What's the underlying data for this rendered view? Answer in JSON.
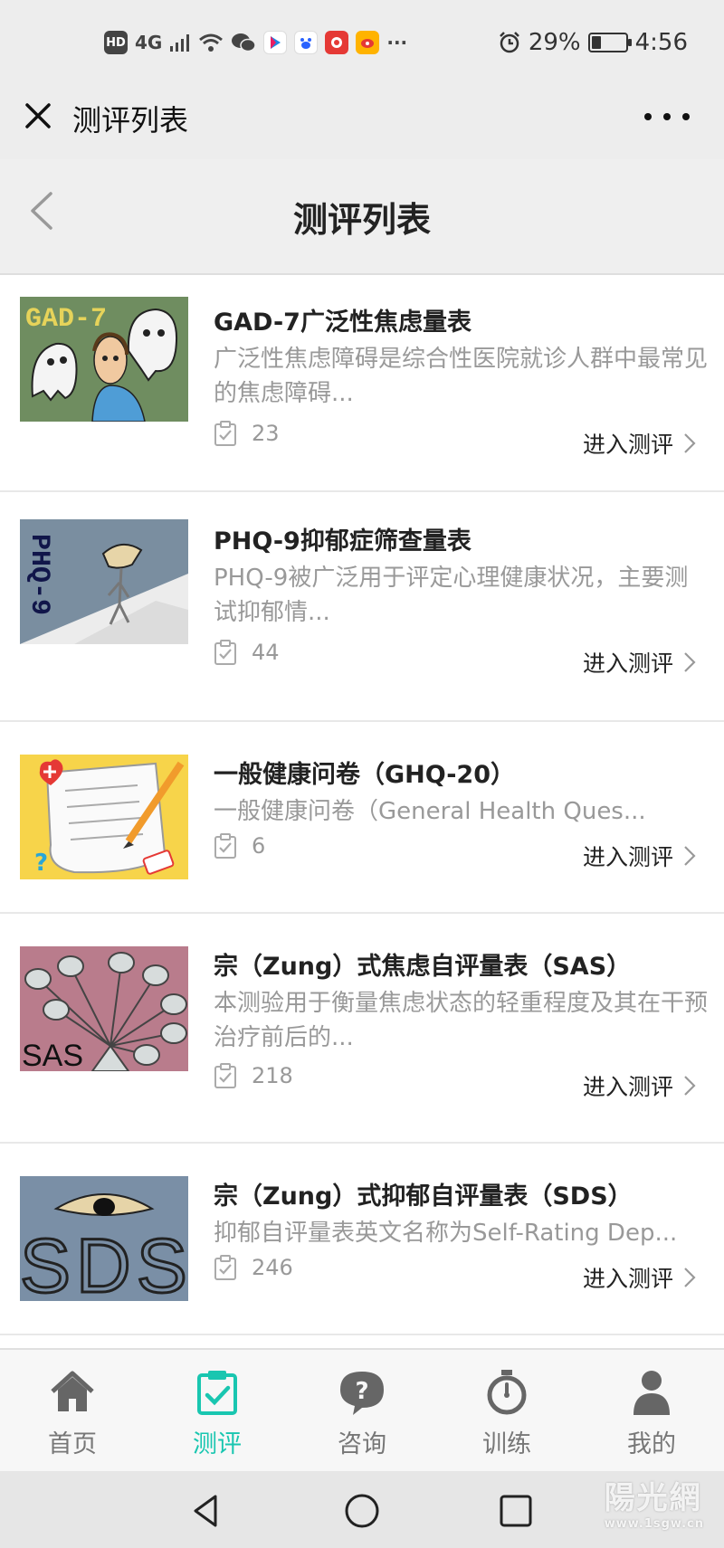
{
  "status_bar": {
    "left_indicators": [
      "HD",
      "4G"
    ],
    "icons": [
      "wifi-icon",
      "wechat-icon",
      "youku-icon",
      "baidu-icon",
      "app-icon",
      "weibo-icon"
    ],
    "overflow": "···",
    "battery": "29%",
    "battery_level": 0.29,
    "time": "4:56"
  },
  "navbar": {
    "title": "测评列表"
  },
  "header": {
    "title": "测评列表"
  },
  "items": [
    {
      "title": "GAD-7广泛性焦虑量表",
      "desc": "广泛性焦虑障碍是综合性医院就诊人群中最常见的焦虑障碍...",
      "count": "23",
      "action": "进入测评",
      "thumb_text": "GAD-7"
    },
    {
      "title": "PHQ-9抑郁症筛查量表",
      "desc": "PHQ-9被广泛用于评定心理健康状况，主要测试抑郁情...",
      "count": "44",
      "action": "进入测评",
      "thumb_text": "PHQ-9"
    },
    {
      "title": "一般健康问卷（GHQ-20）",
      "desc": "一般健康问卷（General Health Ques...",
      "count": "6",
      "action": "进入测评"
    },
    {
      "title": "宗（Zung）式焦虑自评量表（SAS）",
      "desc": "本测验用于衡量焦虑状态的轻重程度及其在干预治疗前后的...",
      "count": "218",
      "action": "进入测评",
      "thumb_text": "SAS"
    },
    {
      "title": "宗（Zung）式抑郁自评量表（SDS）",
      "desc": "抑郁自评量表英文名称为Self-Rating Dep...",
      "count": "246",
      "action": "进入测评",
      "thumb_text": "SDS"
    }
  ],
  "tabs": [
    {
      "label": "首页",
      "icon": "home-icon",
      "active": false
    },
    {
      "label": "测评",
      "icon": "clipboard-check-icon",
      "active": true
    },
    {
      "label": "咨询",
      "icon": "question-bubble-icon",
      "active": false
    },
    {
      "label": "训练",
      "icon": "stopwatch-icon",
      "active": false
    },
    {
      "label": "我的",
      "icon": "user-icon",
      "active": false
    }
  ],
  "watermark": {
    "text": "陽光網",
    "sub": "www.1sgw.cn"
  },
  "colors": {
    "accent": "#19c6b0",
    "inactive_tab": "#666666",
    "muted_text": "#999999"
  }
}
